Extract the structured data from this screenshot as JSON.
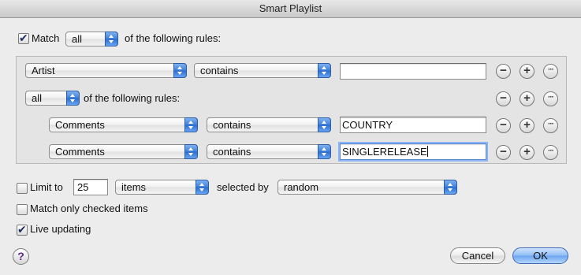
{
  "window": {
    "title": "Smart Playlist"
  },
  "match": {
    "checked": true,
    "label_prefix": "Match",
    "mode": "all",
    "label_suffix": "of the following rules:"
  },
  "rules": [
    {
      "field": "Artist",
      "operator": "contains",
      "value": ""
    }
  ],
  "nested_group": {
    "mode": "all",
    "label_suffix": "of the following rules:",
    "rules": [
      {
        "field": "Comments",
        "operator": "contains",
        "value": "COUNTRY"
      },
      {
        "field": "Comments",
        "operator": "contains",
        "value": "SINGLERELEASE"
      }
    ]
  },
  "rule_buttons": {
    "remove": "−",
    "add": "+",
    "more": "···"
  },
  "limit": {
    "checked": false,
    "label": "Limit to",
    "value": "25",
    "unit": "items",
    "selected_by_label": "selected by",
    "selected_by": "random"
  },
  "match_only_checked": {
    "checked": false,
    "label": "Match only checked items"
  },
  "live_updating": {
    "checked": true,
    "label": "Live updating"
  },
  "buttons": {
    "help": "?",
    "cancel": "Cancel",
    "ok": "OK"
  }
}
